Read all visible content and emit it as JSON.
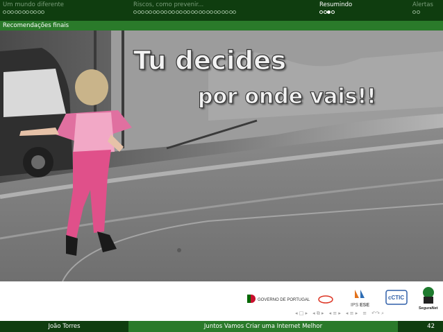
{
  "header": {
    "sections": [
      {
        "title": "Um mundo diferente",
        "dots": 11,
        "active": false
      },
      {
        "title": "Riscos, como prevenir...",
        "dots": 27,
        "active": false
      },
      {
        "title": "Resumindo",
        "dots": 4,
        "active": true,
        "current_index": 2
      },
      {
        "title": "Alertas",
        "dots": 2,
        "active": false
      }
    ],
    "subsection": "Recomendações finais"
  },
  "slide": {
    "title_line1": "Tu decides",
    "title_line2": "por onde vais!!"
  },
  "logos": {
    "gov_text": "GOVERNO DE PORTUGAL",
    "ips_text": "IPS",
    "ese_text": "ESE",
    "cctic_text": "cCTIC",
    "seguranet_text": "SeguraNet"
  },
  "footer": {
    "author": "João Torres",
    "title": "Juntos Vamos Criar uma Internet Melhor",
    "page": "42"
  },
  "colors": {
    "header_dark": "#0f3d0f",
    "header_light": "#2a7a2a",
    "skirt_pink": "#e0508a"
  }
}
